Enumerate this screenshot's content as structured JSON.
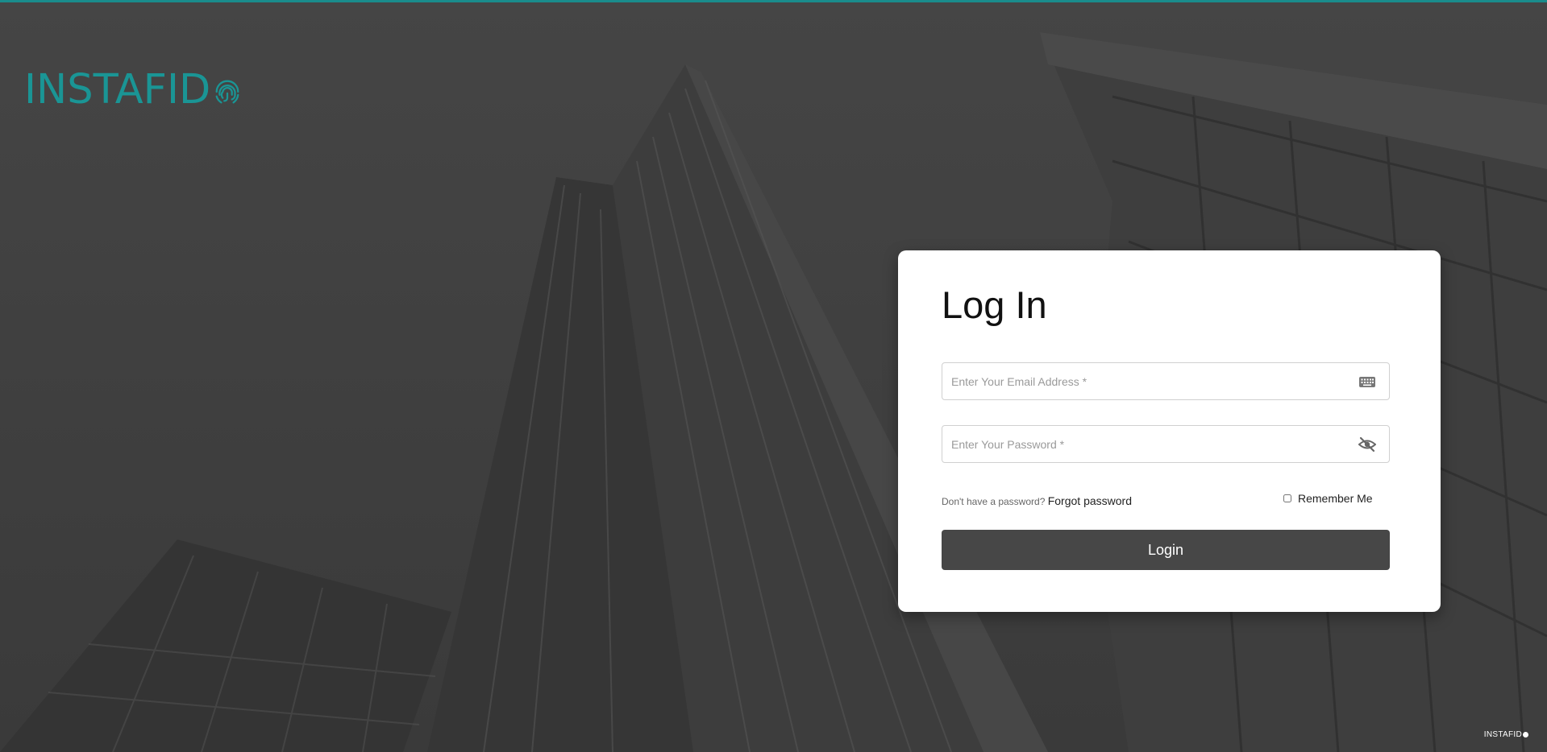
{
  "brand": {
    "logo_text": "INSTAFID",
    "footer_text": "INSTAFID",
    "accent_color": "#1a9595",
    "logo_icon": "fingerprint-icon"
  },
  "login": {
    "title": "Log In",
    "email_placeholder": "Enter Your Email Address *",
    "email_icon": "keyboard-icon",
    "password_placeholder": "Enter Your Password *",
    "password_icon": "eye-off-icon",
    "no_password_text": "Don't have a password?",
    "forgot_label": "Forgot password",
    "remember_label": "Remember Me",
    "login_label": "Login",
    "button_color": "#474747"
  }
}
